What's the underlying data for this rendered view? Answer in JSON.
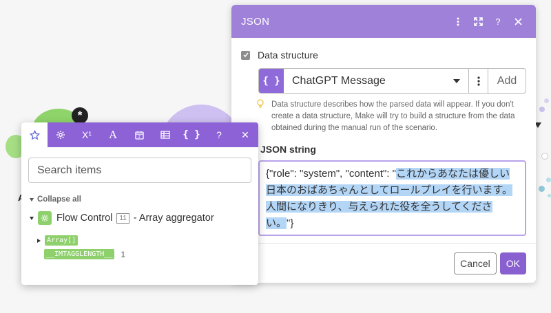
{
  "json_panel": {
    "title": "JSON",
    "header_icons": [
      "more-icon",
      "expand-icon",
      "help-icon",
      "close-icon"
    ],
    "help_label": "?",
    "data_structure_label": "Data structure",
    "selected_structure": "ChatGPT Message",
    "structure_icon_text": "{ }",
    "add_label": "Add",
    "hint": "Data structure describes how the parsed data will appear. If you don't create a data structure, Make will try to build a structure from the data obtained during the manual run of the scenario.",
    "json_string_label": "JSON string",
    "json_value_prefix": "{\"role\": \"system\", \"content\": \"",
    "json_value_highlight": "これからあなたは優しい日本のおばあちゃんとしてロールプレイを行います。人間になりきり、与えられた役を全うしてください。",
    "json_value_suffix": "\"}",
    "cancel_label": "Cancel",
    "ok_label": "OK",
    "colors": {
      "header": "#9f81d9",
      "ok_button": "#8860d0",
      "highlight": "#b3d6f7"
    }
  },
  "items_panel": {
    "tab_icons": [
      "star-icon",
      "gear-icon",
      "superscript-icon",
      "text-icon",
      "calendar-icon",
      "table-icon",
      "braces-icon",
      "help-icon",
      "close-icon"
    ],
    "tab_labels": {
      "superscript": "X¹",
      "text": "A",
      "braces": "{ }",
      "help": "?",
      "close": "✕"
    },
    "search_placeholder": "Search items",
    "collapse_label": "Collapse all",
    "module_name": "Flow Control",
    "module_badge": "11",
    "module_suffix": "- Array aggregator",
    "items": [
      {
        "label": "Array[]",
        "value": ""
      },
      {
        "label": "__IMTAGGLENGTH__",
        "value": "1"
      }
    ]
  }
}
